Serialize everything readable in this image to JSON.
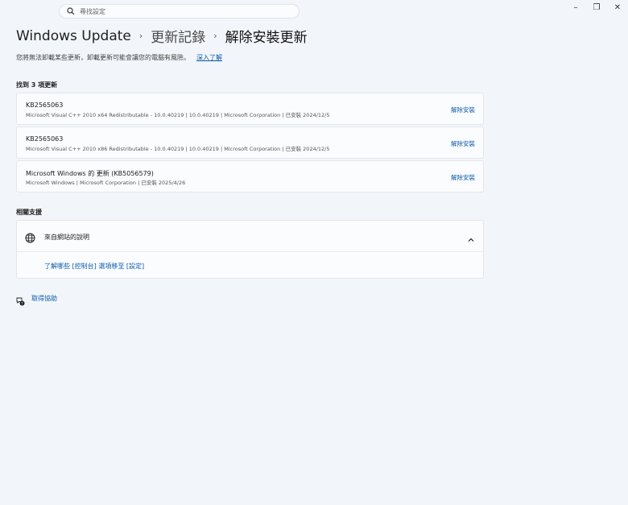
{
  "search": {
    "placeholder": "尋找設定",
    "icon": "search-icon"
  },
  "window_controls": {
    "minimize": "–",
    "maximize": "❐",
    "close": "✕"
  },
  "breadcrumb": {
    "items": [
      "Windows Update",
      "更新記錄",
      "解除安裝更新"
    ],
    "separator": "›"
  },
  "description": {
    "text": "您將無法卸載某些更新，卸載更新可能會讓您的電腦有風險。",
    "link": "深入了解"
  },
  "updates": {
    "header": "找到 3 項更新",
    "items": [
      {
        "name": "KB2565063",
        "details": "Microsoft Visual C++ 2010  x64 Redistributable - 10.0.40219  |  10.0.40219  |  Microsoft Corporation  |  已安裝 2024/12/5",
        "action": "解除安裝"
      },
      {
        "name": "KB2565063",
        "details": "Microsoft Visual C++ 2010  x86 Redistributable - 10.0.40219  |  10.0.40219  |  Microsoft Corporation  |  已安裝 2024/12/5",
        "action": "解除安裝"
      },
      {
        "name": "Microsoft Windows 的 更新 (KB5056579)",
        "details": "Microsoft Windows  |  Microsoft Corporation  |  已安裝 2025/4/26",
        "action": "解除安裝"
      }
    ]
  },
  "support": {
    "header": "相關支援",
    "card_title": "來自網站的說明",
    "link": "了解哪些 [控制台] 選項移至 [設定]"
  },
  "help": {
    "label": "取得協助"
  },
  "colors": {
    "accent": "#0b5cad",
    "background": "#f2f5fa",
    "card": "#fbfcfe"
  }
}
